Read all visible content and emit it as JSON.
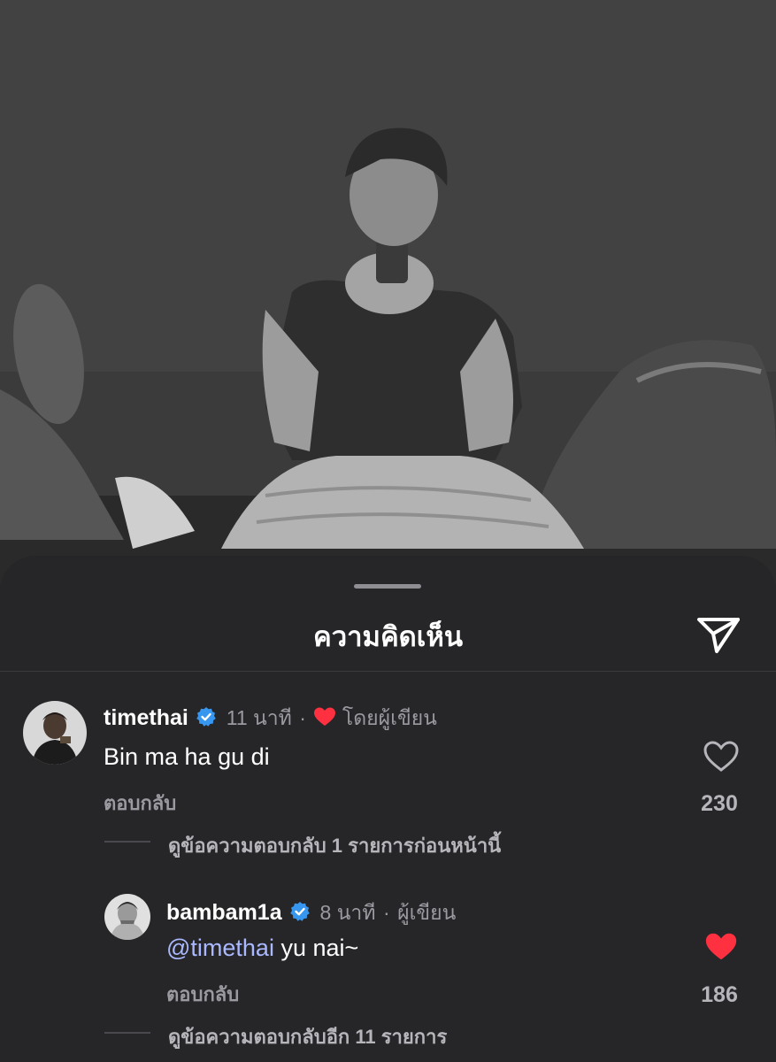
{
  "sheet": {
    "title": "ความคิดเห็น",
    "share_icon": "send-icon"
  },
  "comments": [
    {
      "username": "timethai",
      "verified": true,
      "time": "11 นาที",
      "separator": "·",
      "liked_by_author_label": "โดยผู้เขียน",
      "text": "Bin ma ha gu di",
      "reply_label": "ตอบกลับ",
      "likes": "230",
      "liked": false,
      "view_replies": "ดูข้อความตอบกลับ 1 รายการก่อนหน้านี้"
    },
    {
      "username": "bambam1a",
      "verified": true,
      "time": "8 นาที",
      "separator": "·",
      "author_label": "ผู้เขียน",
      "mention": "@timethai",
      "text": " yu nai~",
      "reply_label": "ตอบกลับ",
      "likes": "186",
      "liked": true,
      "view_replies": "ดูข้อความตอบกลับอีก 11 รายการ"
    }
  ],
  "colors": {
    "sheet_bg": "#262629",
    "verified": "#3797f0",
    "heart_red": "#ff3040",
    "mention": "#a9b8ff"
  }
}
